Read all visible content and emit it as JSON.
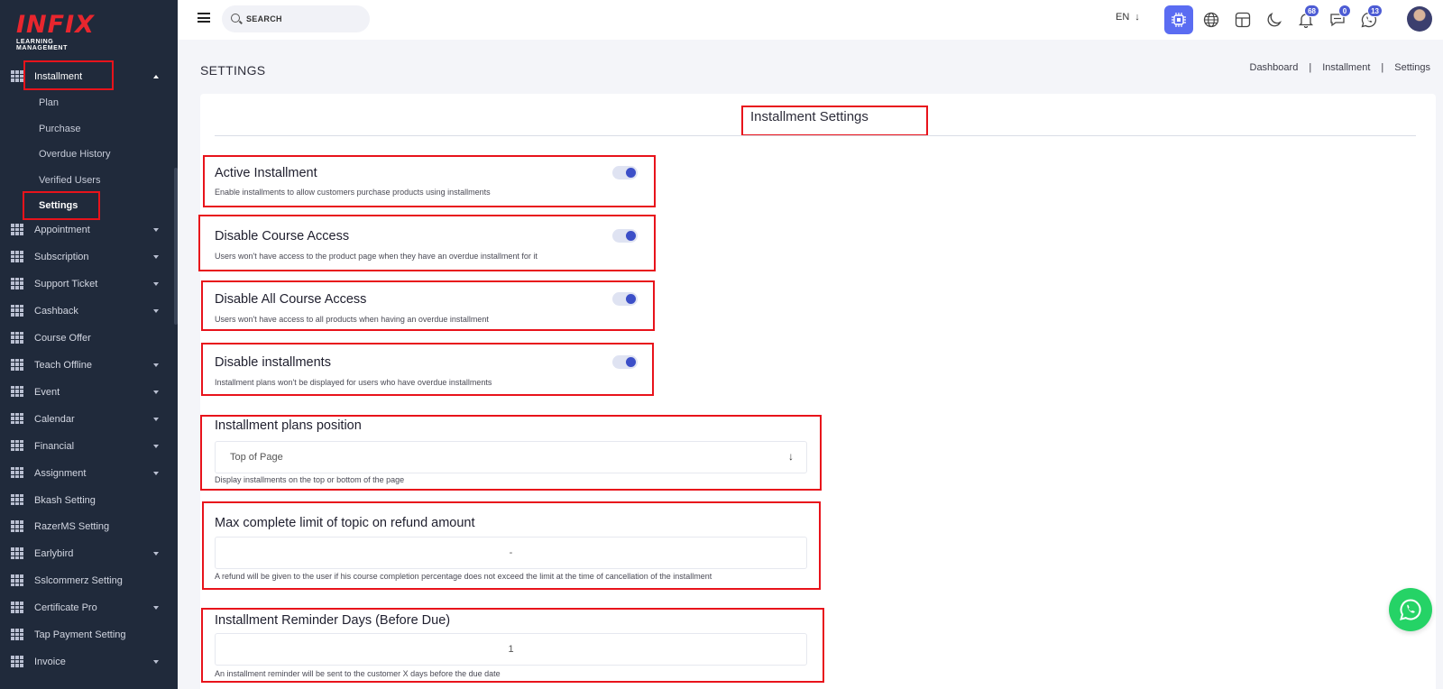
{
  "brand": {
    "logo_text": "INFIX",
    "logo_sub": "LEARNING MANAGEMENT"
  },
  "search": {
    "placeholder": "SEARCH"
  },
  "header": {
    "language": "EN",
    "notifications_count": "68",
    "messages_count": "0",
    "chat_count": "13"
  },
  "sidebar": {
    "active_menu": "Installment",
    "sub_items": [
      "Plan",
      "Purchase",
      "Overdue History",
      "Verified Users",
      "Settings"
    ],
    "menu": [
      {
        "label": "Appointment",
        "caret": true
      },
      {
        "label": "Subscription",
        "caret": true
      },
      {
        "label": "Support Ticket",
        "caret": true
      },
      {
        "label": "Cashback",
        "caret": true
      },
      {
        "label": "Course Offer",
        "caret": false
      },
      {
        "label": "Teach Offline",
        "caret": true
      },
      {
        "label": "Event",
        "caret": true
      },
      {
        "label": "Calendar",
        "caret": true
      },
      {
        "label": "Financial",
        "caret": true
      },
      {
        "label": "Assignment",
        "caret": true
      },
      {
        "label": "Bkash Setting",
        "caret": false
      },
      {
        "label": "RazerMS Setting",
        "caret": false
      },
      {
        "label": "Earlybird",
        "caret": true
      },
      {
        "label": "Sslcommerz Setting",
        "caret": false
      },
      {
        "label": "Certificate Pro",
        "caret": true
      },
      {
        "label": "Tap Payment Setting",
        "caret": false
      },
      {
        "label": "Invoice",
        "caret": true
      }
    ]
  },
  "page": {
    "title": "SETTINGS",
    "breadcrumb": [
      "Dashboard",
      "Installment",
      "Settings"
    ],
    "card_title": "Installment Settings"
  },
  "settings": {
    "active_installment": {
      "title": "Active Installment",
      "desc": "Enable installments to allow customers purchase products using installments",
      "enabled": true
    },
    "disable_course_access": {
      "title": "Disable Course Access",
      "desc": "Users won't have access to the product page when they have an overdue installment for it",
      "enabled": true
    },
    "disable_all_course_access": {
      "title": "Disable All Course Access",
      "desc": "Users won't have access to all products when having an overdue installment",
      "enabled": true
    },
    "disable_installments": {
      "title": "Disable installments",
      "desc": "Installment plans won't be displayed for users who have overdue installments",
      "enabled": true
    },
    "plans_position": {
      "title": "Installment plans position",
      "value": "Top of Page",
      "desc": "Display installments on the top or bottom of the page"
    },
    "max_limit": {
      "title": "Max complete limit of topic on refund amount",
      "value": "-",
      "desc": "A refund will be given to the user if his course completion percentage does not exceed the limit at the time of cancellation of the installment"
    },
    "reminder_days": {
      "title": "Installment Reminder Days (Before Due)",
      "value": "1",
      "desc": "An installment reminder will be sent to the customer X days before the due date"
    }
  },
  "colors": {
    "sidebar_bg": "#202a3b",
    "accent": "#5a6cf2",
    "highlight": "#e8131b",
    "toggle_on": "#3c4fc8",
    "whatsapp": "#25d366"
  }
}
